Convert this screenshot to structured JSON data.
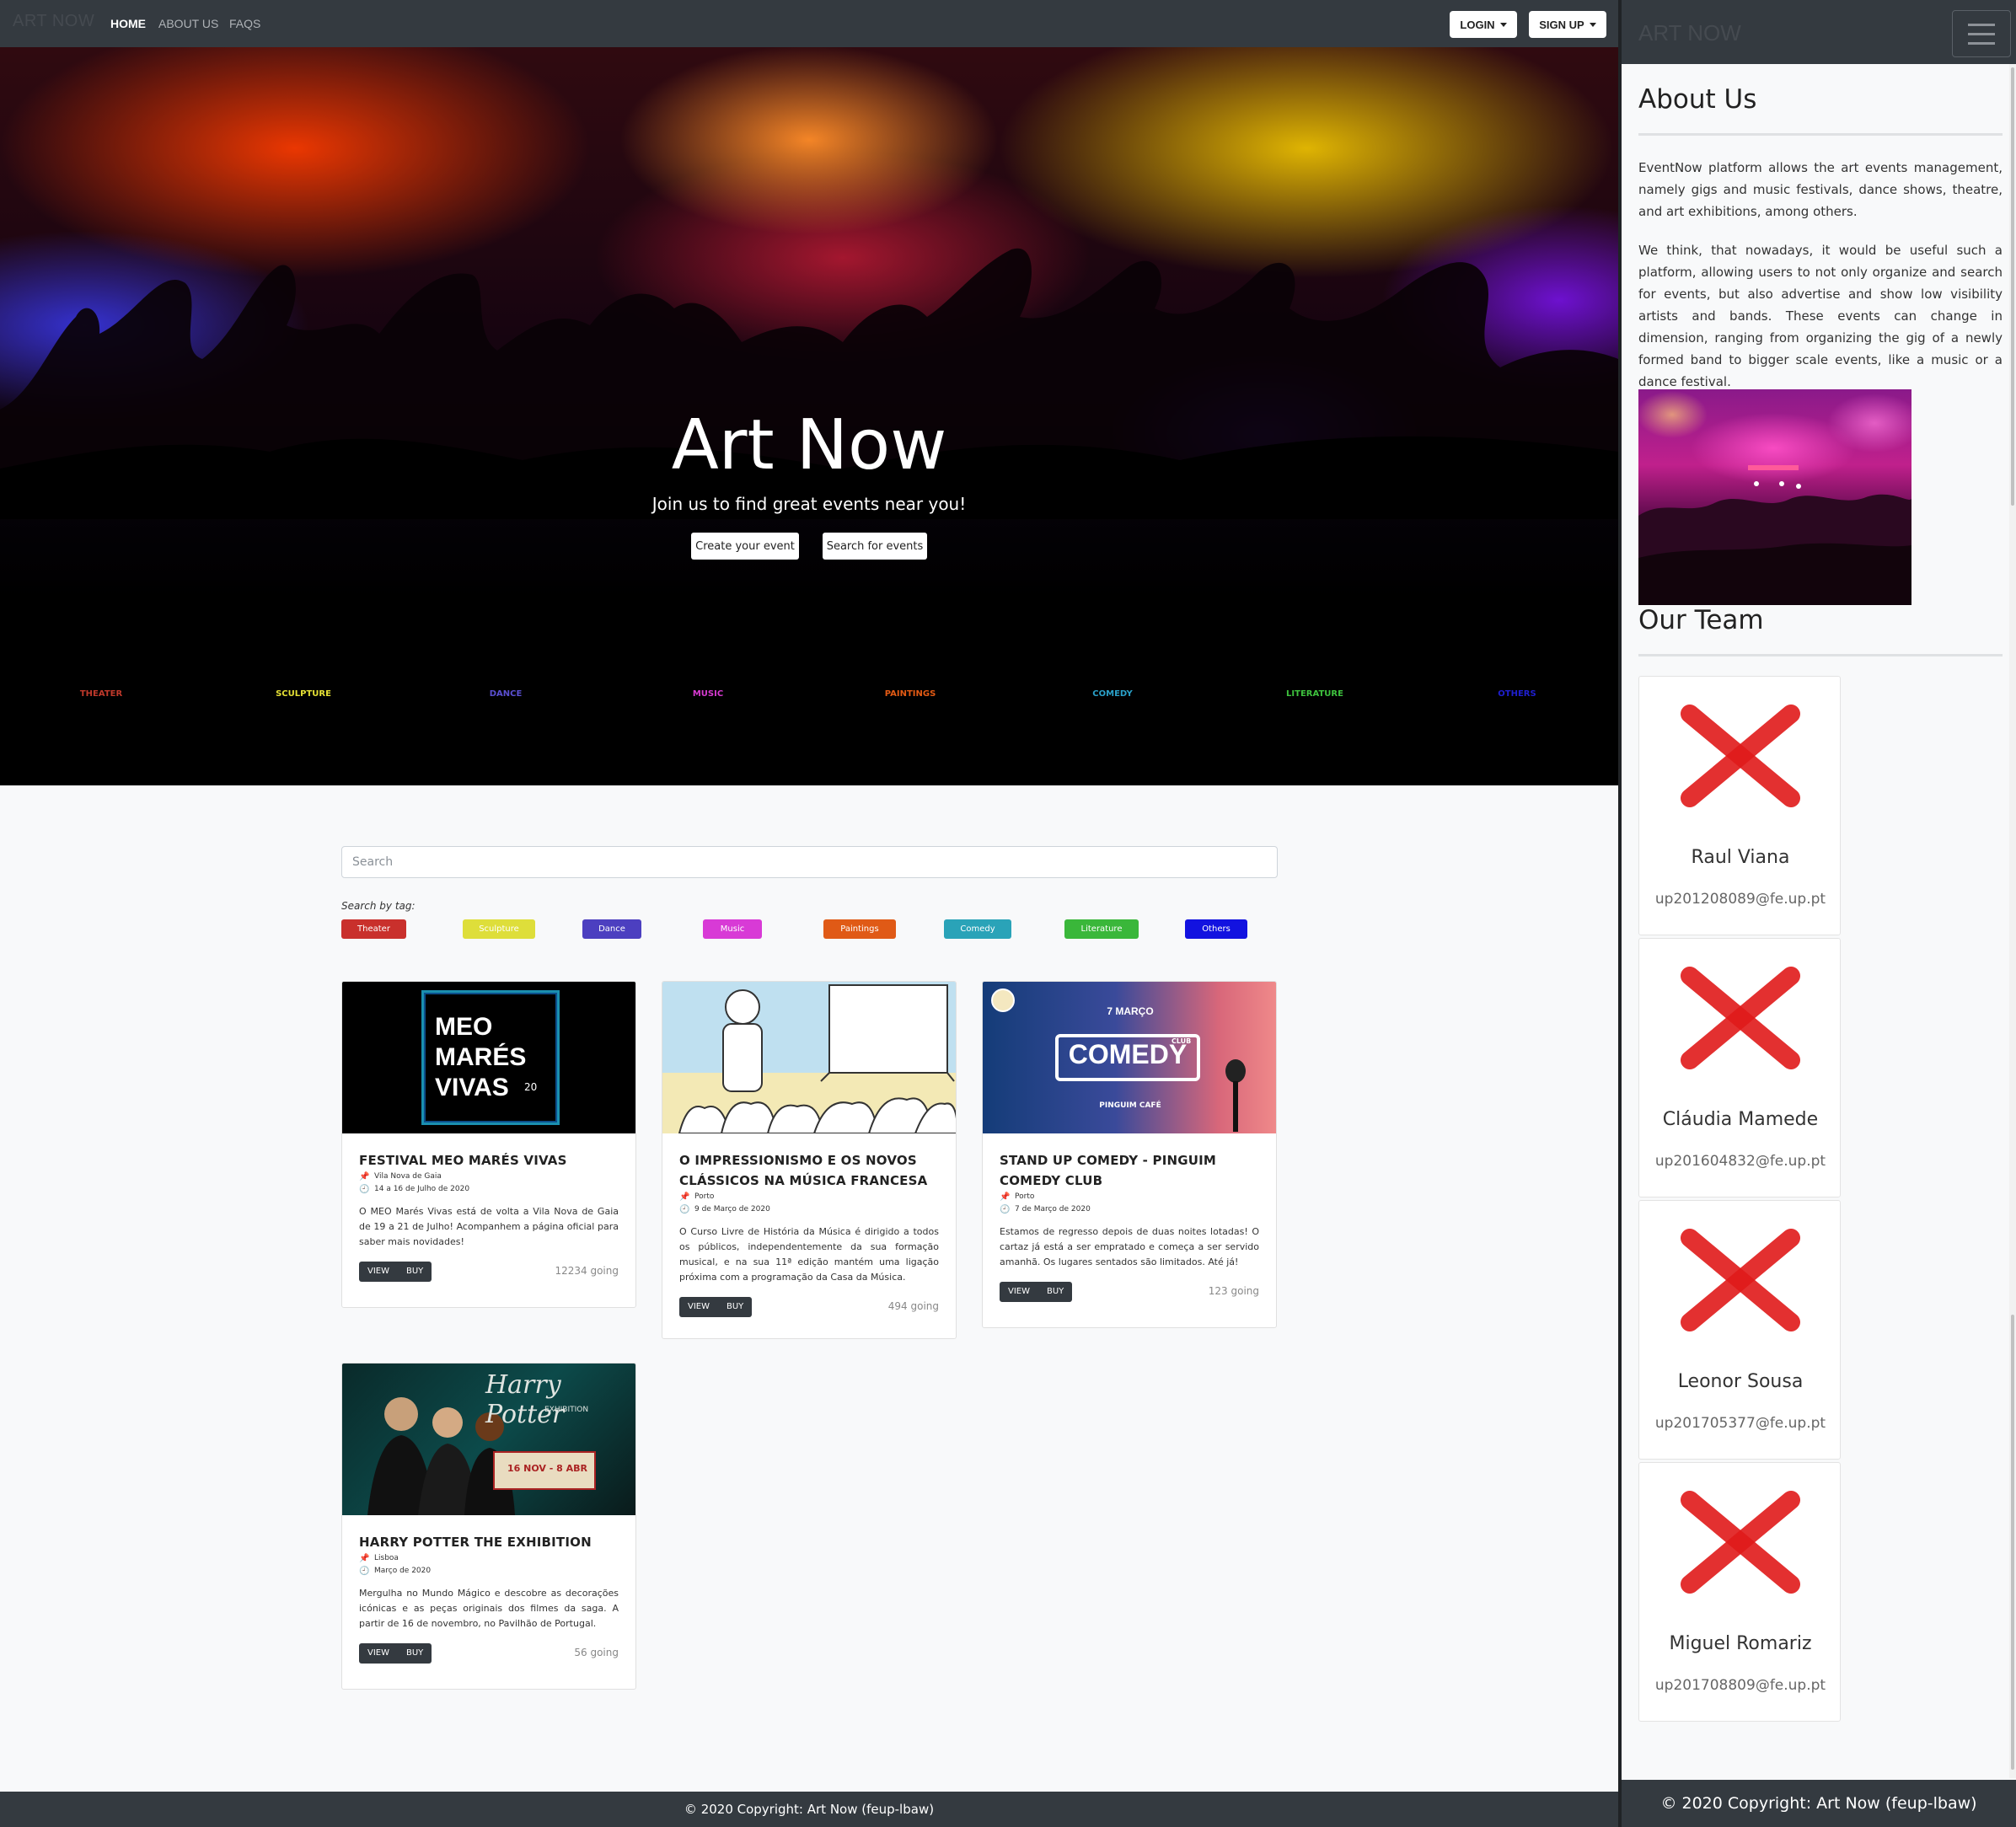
{
  "nav": {
    "brand": "ART NOW",
    "links": [
      "HOME",
      "ABOUT US",
      "FAQS"
    ],
    "login": "LOGIN",
    "signup": "SIGN UP"
  },
  "hero": {
    "title": "Art Now",
    "subtitle": "Join us to find great events near you!",
    "create_btn": "Create your event",
    "search_btn": "Search for events"
  },
  "categories": [
    {
      "label": "THEATER",
      "color": "#c0392b"
    },
    {
      "label": "SCULPTURE",
      "color": "#e6e135"
    },
    {
      "label": "DANCE",
      "color": "#5a4fd0"
    },
    {
      "label": "MUSIC",
      "color": "#d63ad0"
    },
    {
      "label": "PAINTINGS",
      "color": "#e35a14"
    },
    {
      "label": "COMEDY",
      "color": "#2aa0c8"
    },
    {
      "label": "LITERATURE",
      "color": "#3ec23e"
    },
    {
      "label": "OTHERS",
      "color": "#1f1fd0"
    }
  ],
  "search": {
    "placeholder": "Search",
    "tag_label": "Search by tag:",
    "tags": [
      {
        "label": "Theater",
        "color": "#c9302c"
      },
      {
        "label": "Sculpture",
        "color": "#dede3a"
      },
      {
        "label": "Dance",
        "color": "#4c3fc0"
      },
      {
        "label": "Music",
        "color": "#d83ad6"
      },
      {
        "label": "Paintings",
        "color": "#e05a16"
      },
      {
        "label": "Comedy",
        "color": "#2aa3b8"
      },
      {
        "label": "Literature",
        "color": "#3ab73a"
      },
      {
        "label": "Others",
        "color": "#1212e0"
      }
    ]
  },
  "events": [
    {
      "title": "FESTIVAL MEO MARÉS VIVAS",
      "location": "Vila Nova de Gaia",
      "date": "14 a 16 de Julho de 2020",
      "description": "O MEO Marés Vivas está de volta a Vila Nova de Gaia de 19 a 21 de Julho! Acompanhem a página oficial para saber mais novidades!",
      "view": "VIEW",
      "buy": "BUY",
      "going": "12234 going",
      "poster": [
        "MEO",
        "MARÉS",
        "VIVAS",
        "20"
      ]
    },
    {
      "title": "O IMPRESSIONISMO E OS NOVOS CLÁSSICOS NA MÚSICA FRANCESA",
      "location": "Porto",
      "date": "9 de Março de 2020",
      "description": "O Curso Livre de História da Música é dirigido a todos os públicos, independentemente da sua formação musical, e na sua 11ª edição mantém uma ligação próxima com a programação da Casa da Música.",
      "view": "VIEW",
      "buy": "BUY",
      "going": "494 going"
    },
    {
      "title": "STAND UP COMEDY - PINGUIM COMEDY CLUB",
      "location": "Porto",
      "date": "7 de Março de 2020",
      "description": "Estamos de regresso depois de duas noites lotadas! O cartaz já está a ser empratado e começa a ser servido amanhã. Os lugares sentados são limitados. Até já!",
      "view": "VIEW",
      "buy": "BUY",
      "going": "123 going",
      "poster": [
        "7 MARÇO",
        "COMEDY",
        "CLUB",
        "PINGUIM CAFÉ"
      ]
    },
    {
      "title": "HARRY POTTER THE EXHIBITION",
      "location": "Lisboa",
      "date": "Março de 2020",
      "description": "Mergulha no Mundo Mágico e descobre as decorações icónicas e as peças originais dos filmes da saga. A partir de 16 de novembro, no Pavilhão de Portugal.",
      "view": "VIEW",
      "buy": "BUY",
      "going": "56 going",
      "poster": [
        "Harry Potter",
        "EXHIBITION",
        "16 NOV - 8 ABR"
      ]
    }
  ],
  "footer": "© 2020 Copyright: Art Now (feup-lbaw)",
  "side": {
    "brand": "ART NOW",
    "about_title": "About Us",
    "p1": "EventNow platform allows the art events management, namely gigs and music festivals, dance shows, theatre, and art exhibitions, among others.",
    "p2": "We think, that nowadays, it would be useful such a platform, allowing users to not only organize and search for events, but also advertise and show low visibility artists and bands. These events can change in dimension, ranging from organizing the gig of a newly formed band to bigger scale events, like a music or a dance festival.",
    "team_title": "Our Team",
    "team": [
      {
        "name": "Raul Viana",
        "email": "up201208089@fe.up.pt"
      },
      {
        "name": "Cláudia Mamede",
        "email": "up201604832@fe.up.pt"
      },
      {
        "name": "Leonor Sousa",
        "email": "up201705377@fe.up.pt"
      },
      {
        "name": "Miguel Romariz",
        "email": "up201708809@fe.up.pt"
      }
    ],
    "footer": "© 2020 Copyright: Art Now (feup-lbaw)"
  }
}
